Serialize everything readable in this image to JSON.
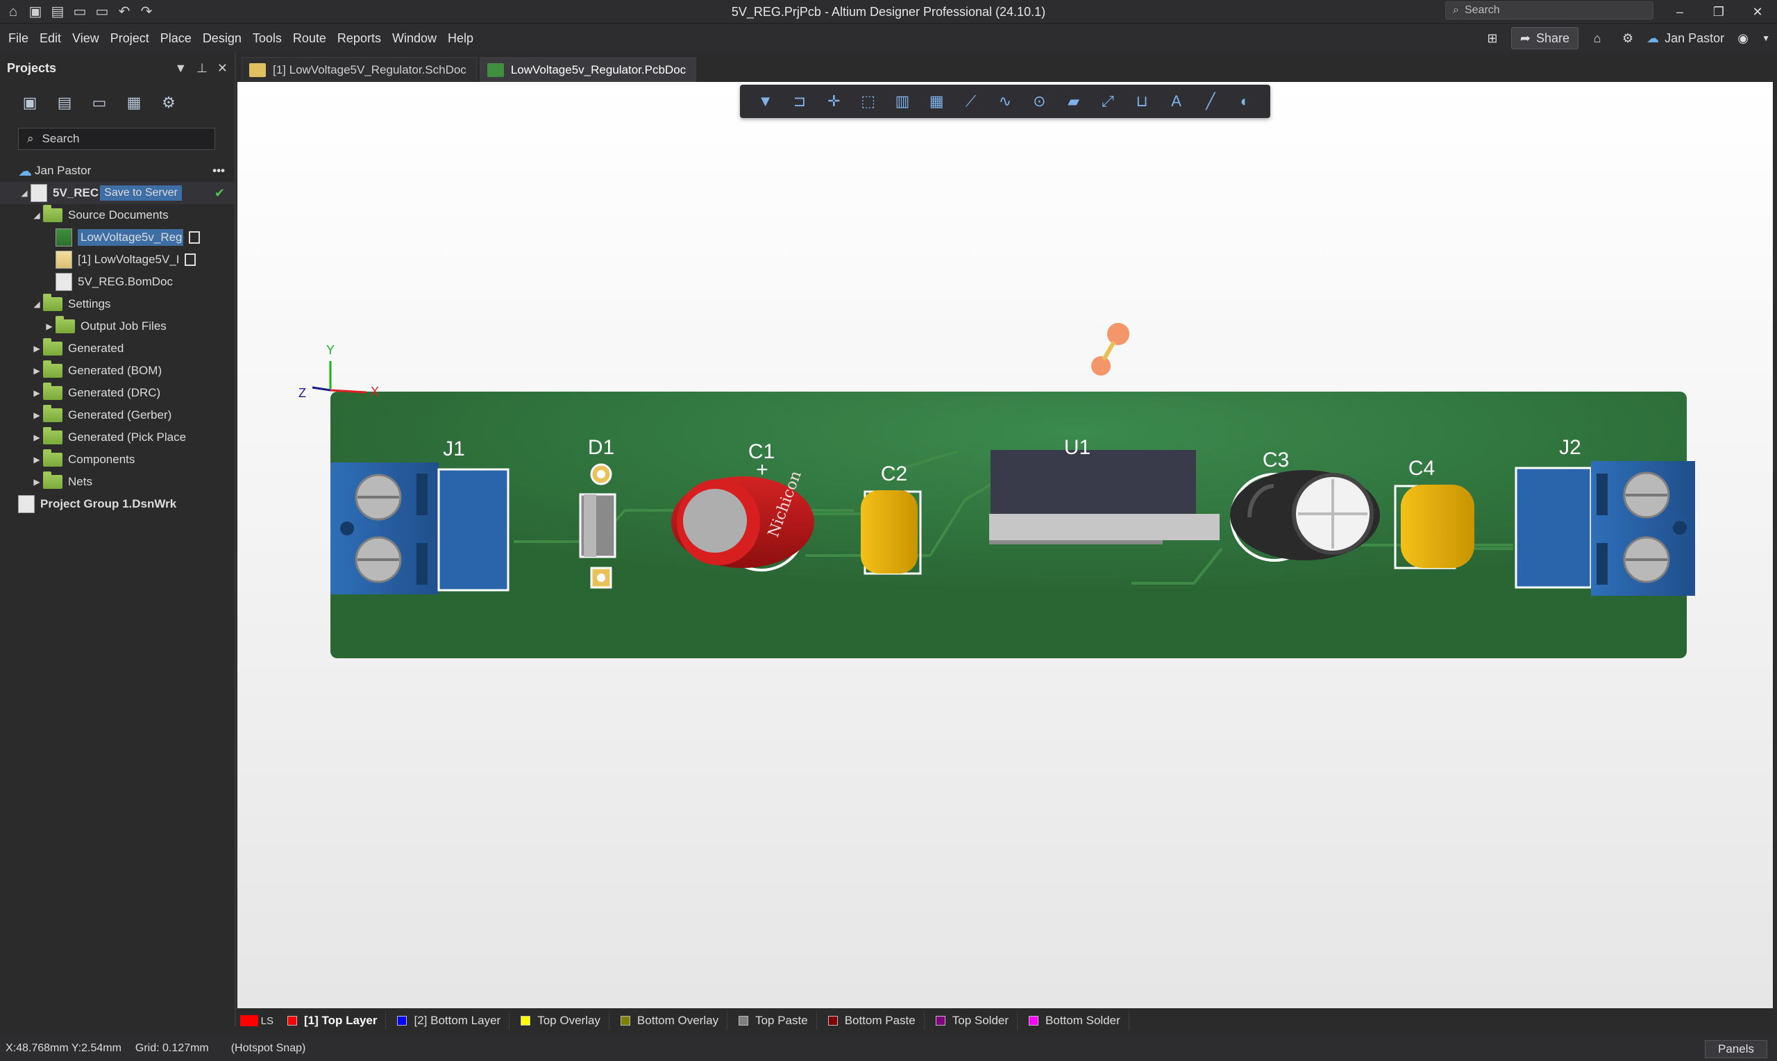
{
  "window": {
    "title": "5V_REG.PrjPcb - Altium Designer Professional (24.10.1)",
    "search_placeholder": "Search"
  },
  "menu": [
    "File",
    "Edit",
    "View",
    "Project",
    "Place",
    "Design",
    "Tools",
    "Route",
    "Reports",
    "Window",
    "Help"
  ],
  "header_right": {
    "share_label": "Share",
    "user": "Jan Pastor"
  },
  "projects_panel": {
    "title": "Projects",
    "search_placeholder": "Search",
    "user": "Jan Pastor",
    "project_name": "5V_REC",
    "save_to_server": "Save to Server",
    "items": [
      {
        "label": "Source Documents"
      },
      {
        "label": "LowVoltage5v_Reg"
      },
      {
        "label": "[1] LowVoltage5V_I"
      },
      {
        "label": "5V_REG.BomDoc"
      },
      {
        "label": "Settings"
      },
      {
        "label": "Output Job Files"
      },
      {
        "label": "Generated"
      },
      {
        "label": "Generated (BOM)"
      },
      {
        "label": "Generated (DRC)"
      },
      {
        "label": "Generated (Gerber)"
      },
      {
        "label": "Generated (Pick Place"
      },
      {
        "label": "Components"
      },
      {
        "label": "Nets"
      }
    ],
    "group": "Project Group 1.DsnWrk"
  },
  "tabs": [
    {
      "label": "[1] LowVoltage5V_Regulator.SchDoc"
    },
    {
      "label": "LowVoltage5v_Regulator.PcbDoc"
    }
  ],
  "pcb": {
    "designators": [
      "J1",
      "D1",
      "C1",
      "C2",
      "U1",
      "C3",
      "C4",
      "J2"
    ],
    "plus": "+",
    "axes": {
      "x": "X",
      "y": "Y",
      "z": "Z"
    }
  },
  "layers": {
    "ls": "LS",
    "items": [
      {
        "label": "[1] Top Layer",
        "color": "#ff0000"
      },
      {
        "label": "[2] Bottom Layer",
        "color": "#0000ff"
      },
      {
        "label": "Top Overlay",
        "color": "#ffff00"
      },
      {
        "label": "Bottom Overlay",
        "color": "#808000"
      },
      {
        "label": "Top Paste",
        "color": "#808080"
      },
      {
        "label": "Bottom Paste",
        "color": "#800000"
      },
      {
        "label": "Top Solder",
        "color": "#800080"
      },
      {
        "label": "Bottom Solder",
        "color": "#ff00ff"
      }
    ]
  },
  "status": {
    "coords": "X:48.768mm Y:2.54mm",
    "grid": "Grid: 0.127mm",
    "snap": "(Hotspot Snap)",
    "panels": "Panels"
  },
  "colors": {
    "board": "#2f6e3a",
    "terminal_blue": "#2f6fb8",
    "accent": "#3d6fa6"
  }
}
